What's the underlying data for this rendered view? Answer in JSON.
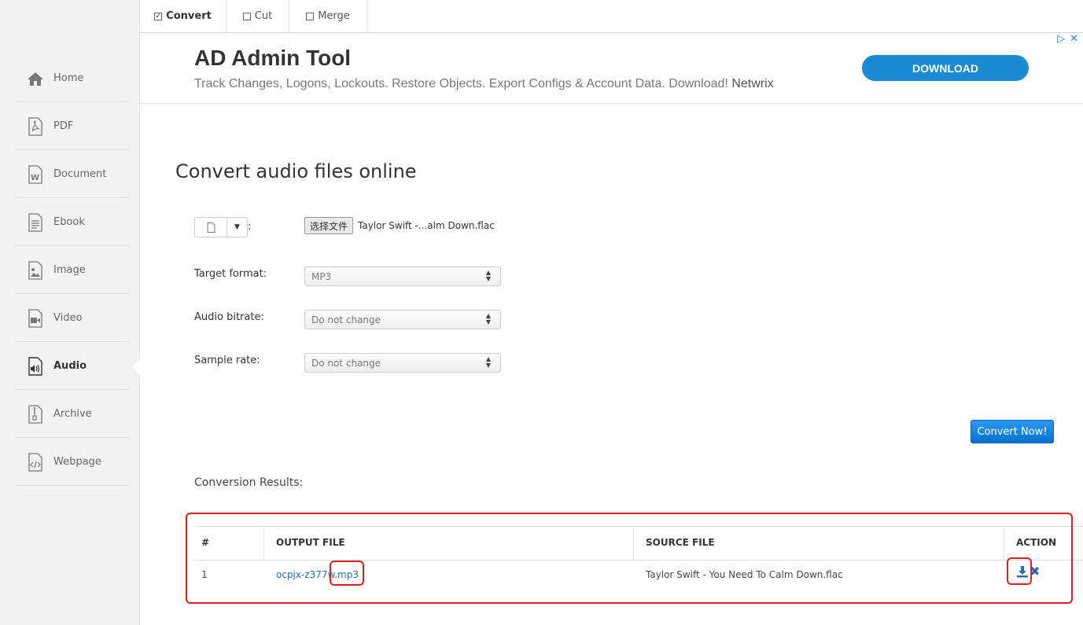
{
  "sidebar": {
    "items": [
      {
        "label": "Home",
        "icon": "home-icon"
      },
      {
        "label": "PDF",
        "icon": "pdf-icon"
      },
      {
        "label": "Document",
        "icon": "document-icon"
      },
      {
        "label": "Ebook",
        "icon": "ebook-icon"
      },
      {
        "label": "Image",
        "icon": "image-icon"
      },
      {
        "label": "Video",
        "icon": "video-icon"
      },
      {
        "label": "Audio",
        "icon": "audio-icon"
      },
      {
        "label": "Archive",
        "icon": "archive-icon"
      },
      {
        "label": "Webpage",
        "icon": "webpage-icon"
      }
    ],
    "active": "Audio"
  },
  "tabs": [
    {
      "label": "Convert",
      "checked": true
    },
    {
      "label": "Cut",
      "checked": false
    },
    {
      "label": "Merge",
      "checked": false
    }
  ],
  "ad": {
    "title": "AD Admin Tool",
    "description": "Track Changes, Logons, Lockouts. Restore Objects. Export Configs & Account Data. Download!",
    "brand": "Netwrix",
    "button_label": "DOWNLOAD"
  },
  "main": {
    "title": "Convert audio files online",
    "file_colon": ":",
    "choose_file_label": "选择文件",
    "chosen_file_name": "Taylor Swift -...alm Down.flac",
    "fields": {
      "target_format": {
        "label": "Target format:",
        "value": "MP3"
      },
      "audio_bitrate": {
        "label": "Audio bitrate:",
        "value": "Do not change"
      },
      "sample_rate": {
        "label": "Sample rate:",
        "value": "Do not change"
      }
    },
    "convert_button": "Convert Now!",
    "results_label": "Conversion Results:"
  },
  "results_table": {
    "headers": {
      "num": "#",
      "output": "OUTPUT FILE",
      "source": "SOURCE FILE",
      "action": "ACTION"
    },
    "rows": [
      {
        "num": "1",
        "output": "ocpjx-z377w.mp3",
        "source": "Taylor Swift - You Need To Calm Down.flac"
      }
    ]
  },
  "colors": {
    "accent": "#1a8ad4",
    "link": "#2b6cb0",
    "highlight_box": "#e0201a",
    "convert_button": "#1a7fe0"
  }
}
